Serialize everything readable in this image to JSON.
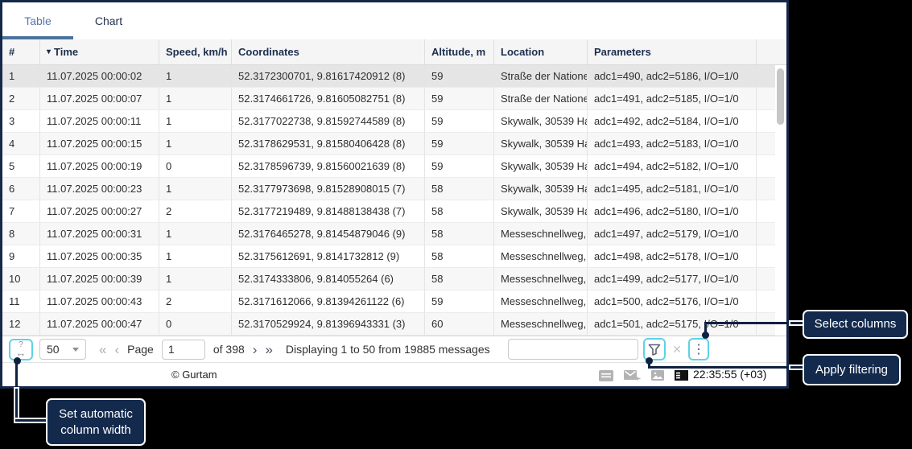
{
  "tabs": [
    {
      "label": "Table",
      "active": true
    },
    {
      "label": "Chart",
      "active": false
    }
  ],
  "table": {
    "columns": [
      "#",
      "Time",
      "Speed, km/h",
      "Coordinates",
      "Altitude, m",
      "Location",
      "Parameters"
    ],
    "sort_column": "Time",
    "sort_direction": "desc",
    "rows": [
      {
        "n": "1",
        "time": "11.07.2025 00:00:02",
        "speed": "1",
        "coords": "52.3172300701, 9.81617420912 (8)",
        "alt": "59",
        "loc": "Straße der Natione",
        "params": "adc1=490, adc2=5186, I/O=1/0",
        "highlighted": true
      },
      {
        "n": "2",
        "time": "11.07.2025 00:00:07",
        "speed": "1",
        "coords": "52.3174661726, 9.81605082751 (8)",
        "alt": "59",
        "loc": "Straße der Natione",
        "params": "adc1=491, adc2=5185, I/O=1/0"
      },
      {
        "n": "3",
        "time": "11.07.2025 00:00:11",
        "speed": "1",
        "coords": "52.3177022738, 9.81592744589 (8)",
        "alt": "59",
        "loc": "Skywalk, 30539 Ha",
        "params": "adc1=492, adc2=5184, I/O=1/0"
      },
      {
        "n": "4",
        "time": "11.07.2025 00:00:15",
        "speed": "1",
        "coords": "52.3178629531, 9.81580406428 (8)",
        "alt": "59",
        "loc": "Skywalk, 30539 Ha",
        "params": "adc1=493, adc2=5183, I/O=1/0"
      },
      {
        "n": "5",
        "time": "11.07.2025 00:00:19",
        "speed": "0",
        "coords": "52.3178596739, 9.81560021639 (8)",
        "alt": "59",
        "loc": "Skywalk, 30539 Ha",
        "params": "adc1=494, adc2=5182, I/O=1/0"
      },
      {
        "n": "6",
        "time": "11.07.2025 00:00:23",
        "speed": "1",
        "coords": "52.3177973698, 9.81528908015 (7)",
        "alt": "58",
        "loc": "Skywalk, 30539 Ha",
        "params": "adc1=495, adc2=5181, I/O=1/0"
      },
      {
        "n": "7",
        "time": "11.07.2025 00:00:27",
        "speed": "2",
        "coords": "52.3177219489, 9.81488138438 (7)",
        "alt": "58",
        "loc": "Skywalk, 30539 Ha",
        "params": "adc1=496, adc2=5180, I/O=1/0"
      },
      {
        "n": "8",
        "time": "11.07.2025 00:00:31",
        "speed": "1",
        "coords": "52.3176465278, 9.81454879046 (9)",
        "alt": "58",
        "loc": "Messeschnellweg,",
        "params": "adc1=497, adc2=5179, I/O=1/0"
      },
      {
        "n": "9",
        "time": "11.07.2025 00:00:35",
        "speed": "1",
        "coords": "52.3175612691, 9.8141732812 (9)",
        "alt": "58",
        "loc": "Messeschnellweg,",
        "params": "adc1=498, adc2=5178, I/O=1/0"
      },
      {
        "n": "10",
        "time": "11.07.2025 00:00:39",
        "speed": "1",
        "coords": "52.3174333806, 9.814055264 (6)",
        "alt": "58",
        "loc": "Messeschnellweg,",
        "params": "adc1=499, adc2=5177, I/O=1/0"
      },
      {
        "n": "11",
        "time": "11.07.2025 00:00:43",
        "speed": "2",
        "coords": "52.3171612066, 9.81394261122 (6)",
        "alt": "59",
        "loc": "Messeschnellweg,",
        "params": "adc1=500, adc2=5176, I/O=1/0"
      },
      {
        "n": "12",
        "time": "11.07.2025 00:00:47",
        "speed": "0",
        "coords": "52.3170529924, 9.81396943331 (3)",
        "alt": "60",
        "loc": "Messeschnellweg,",
        "params": "adc1=501, adc2=5175, I/O=1/0"
      }
    ]
  },
  "pagination": {
    "page_size": "50",
    "page_label": "Page",
    "page_value": "1",
    "of_label": "of 398",
    "first_icon": "«",
    "prev_icon": "‹",
    "next_icon": "›",
    "last_icon": "»",
    "status": "Displaying 1 to 50 from 19885 messages"
  },
  "filter": {
    "value": "",
    "clear_icon": "✕",
    "more_icon": "⋮",
    "autowidth_glyph_top": "?",
    "autowidth_glyph_bottom": "↔"
  },
  "footer": {
    "copyright": "© Gurtam",
    "time": "22:35:55 (+03)",
    "icons": [
      "notes-icon",
      "message-icon",
      "media-icon",
      "panel-icon"
    ]
  },
  "callouts": {
    "select_columns": "Select columns",
    "apply_filtering": "Apply filtering",
    "auto_width": "Set automatic column width"
  },
  "colors": {
    "highlight_accent": "#5ED2E6",
    "callout_bg": "#132A4D",
    "tab_active": "#5576AC",
    "header_text": "#1D2E4E",
    "window_border": "#16284A"
  }
}
